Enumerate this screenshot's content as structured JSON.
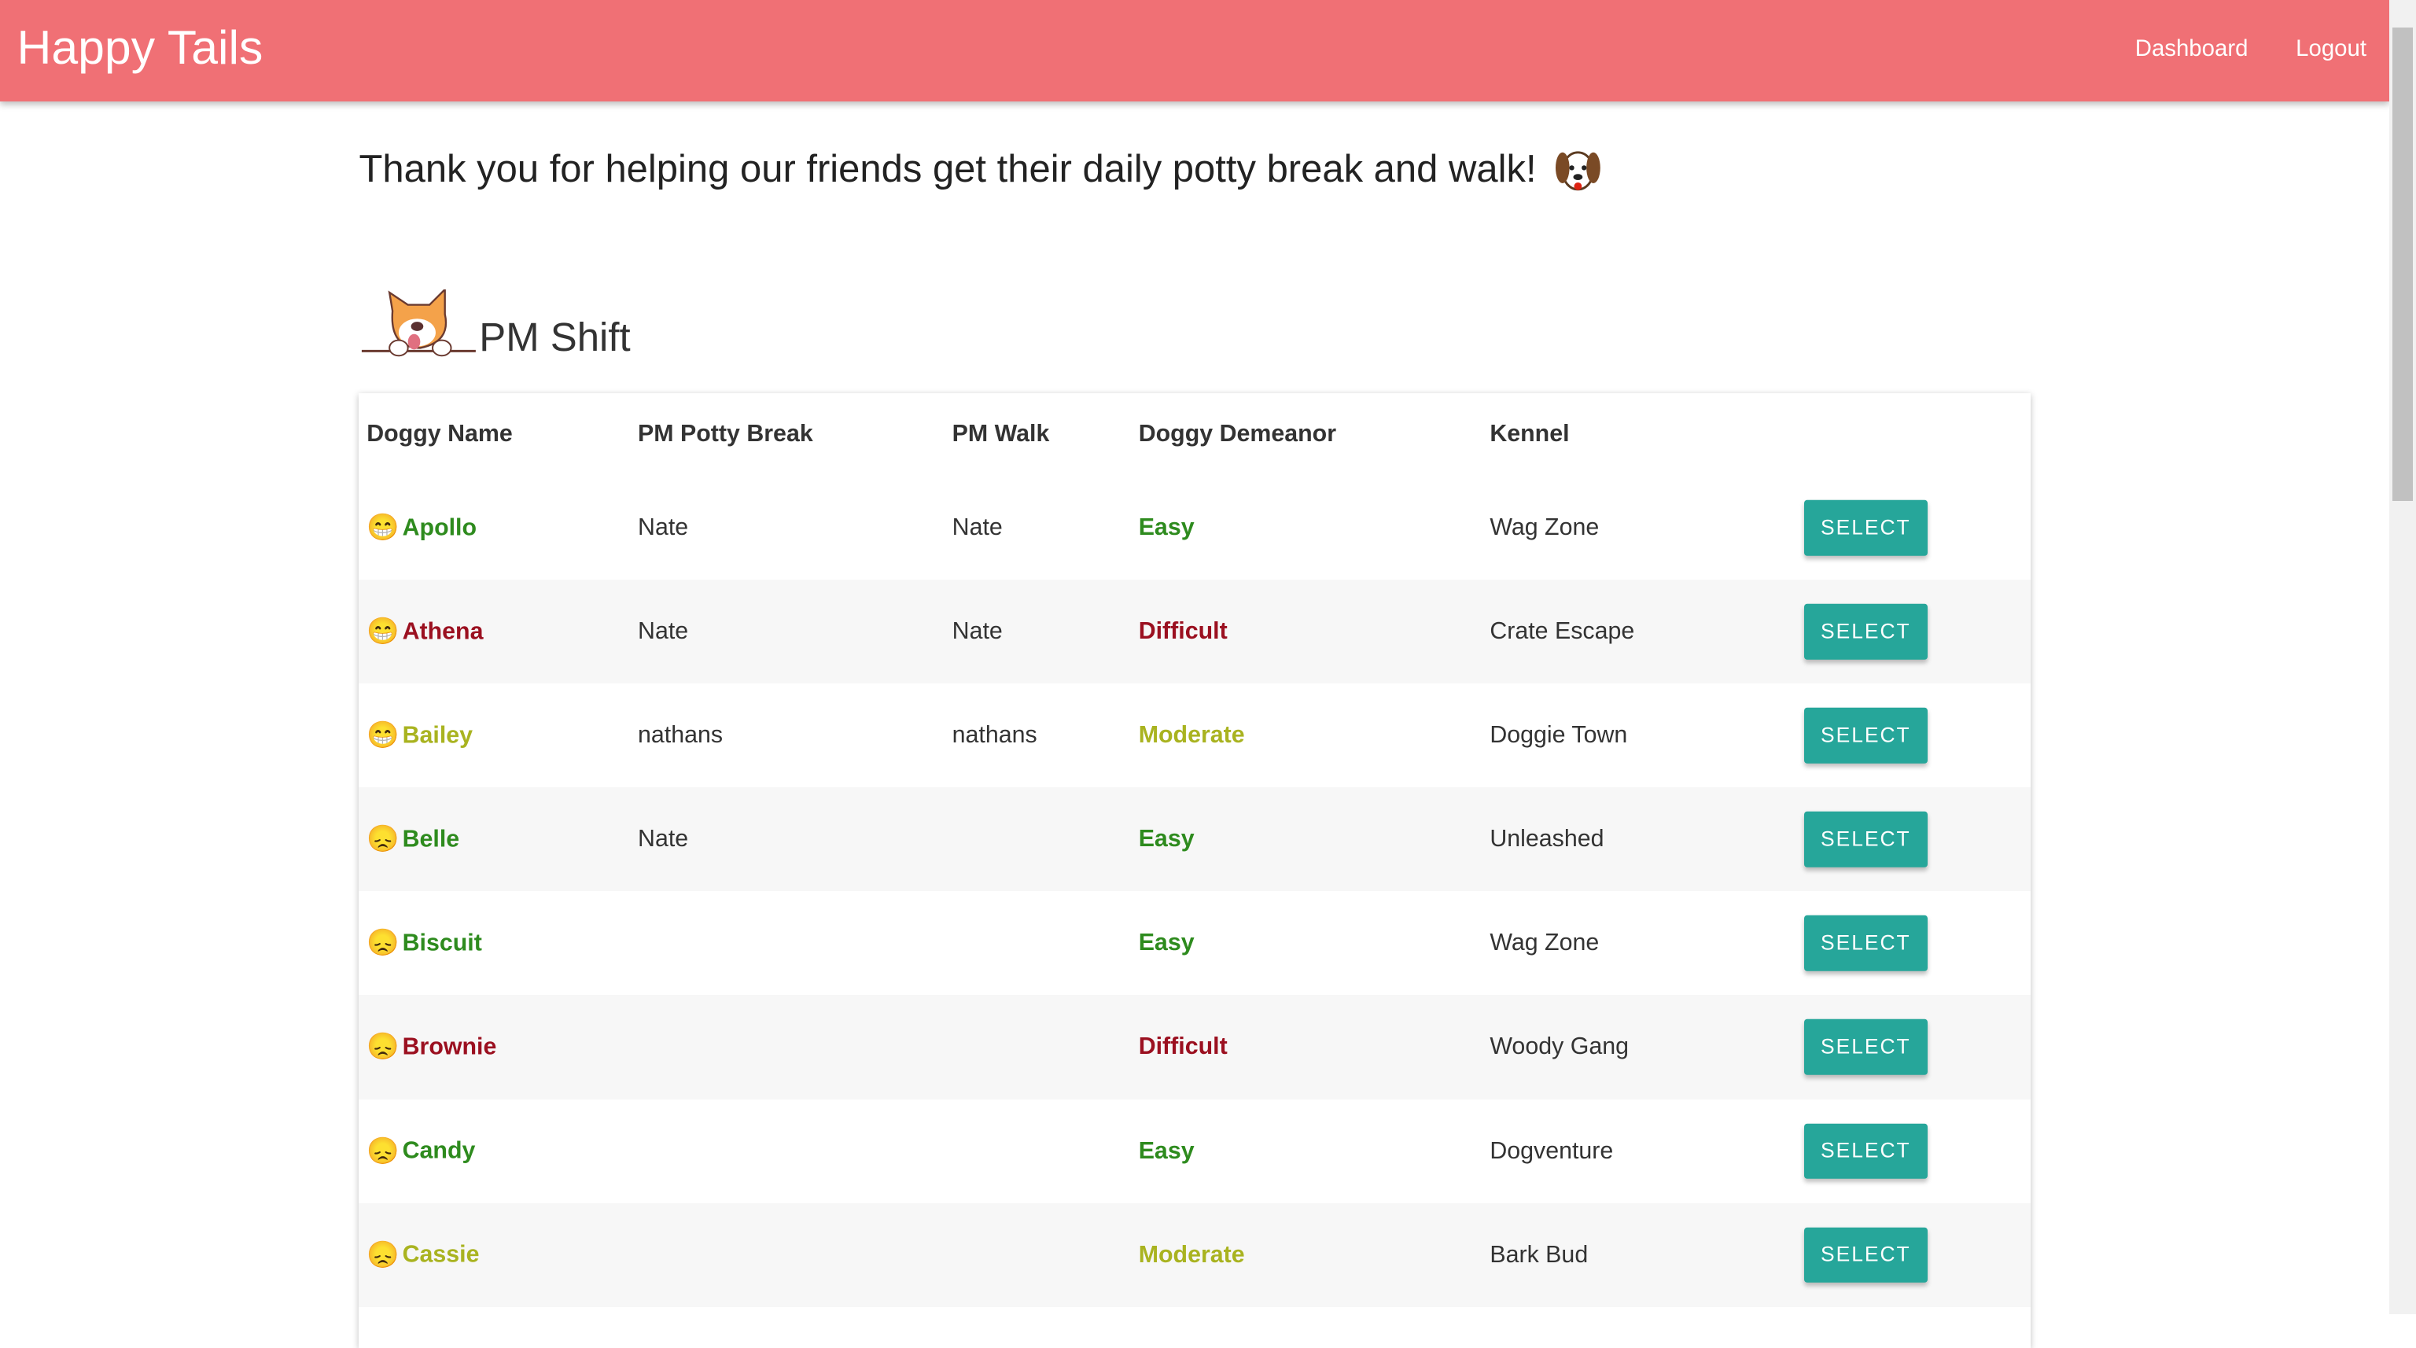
{
  "header": {
    "title": "Happy Tails",
    "links": [
      "Dashboard",
      "Logout"
    ],
    "color": "#f07075"
  },
  "greeting": {
    "text": "Thank you for helping our friends get their daily potty break and walk!",
    "icon": "dog-face-icon"
  },
  "shift": {
    "title": "PM Shift",
    "icon": "shiba-peeking-icon"
  },
  "table": {
    "columns": [
      "Doggy Name",
      "PM Potty Break",
      "PM Walk",
      "Doggy Demeanor",
      "Kennel",
      ""
    ],
    "button_label": "SELECT",
    "demeanor_colors": {
      "Easy": "#2e8b1e",
      "Difficult": "#9b1020",
      "Moderate": "#a9b320"
    },
    "rows": [
      {
        "emoji": "😁",
        "name": "Apollo",
        "potty": "Nate",
        "walk": "Nate",
        "demeanor": "Easy",
        "kennel": "Wag Zone"
      },
      {
        "emoji": "😁",
        "name": "Athena",
        "potty": "Nate",
        "walk": "Nate",
        "demeanor": "Difficult",
        "kennel": "Crate Escape"
      },
      {
        "emoji": "😁",
        "name": "Bailey",
        "potty": "nathans",
        "walk": "nathans",
        "demeanor": "Moderate",
        "kennel": "Doggie Town"
      },
      {
        "emoji": "😞",
        "name": "Belle",
        "potty": "Nate",
        "walk": "",
        "demeanor": "Easy",
        "kennel": "Unleashed"
      },
      {
        "emoji": "😞",
        "name": "Biscuit",
        "potty": "",
        "walk": "",
        "demeanor": "Easy",
        "kennel": "Wag Zone"
      },
      {
        "emoji": "😞",
        "name": "Brownie",
        "potty": "",
        "walk": "",
        "demeanor": "Difficult",
        "kennel": "Woody Gang"
      },
      {
        "emoji": "😞",
        "name": "Candy",
        "potty": "",
        "walk": "",
        "demeanor": "Easy",
        "kennel": "Dogventure"
      },
      {
        "emoji": "😞",
        "name": "Cassie",
        "potty": "",
        "walk": "",
        "demeanor": "Moderate",
        "kennel": "Bark Bud"
      }
    ]
  }
}
